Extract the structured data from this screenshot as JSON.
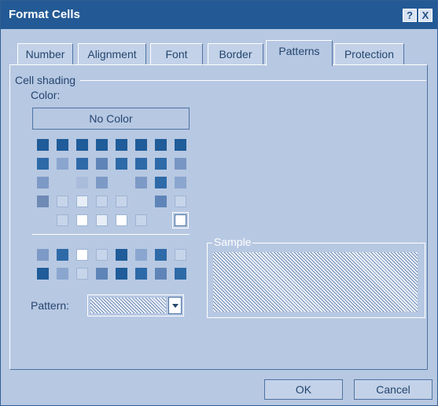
{
  "window": {
    "title": "Format Cells",
    "help_label": "?",
    "close_label": "X"
  },
  "tabs": [
    {
      "label": "Number",
      "active": false
    },
    {
      "label": "Alignment",
      "active": false
    },
    {
      "label": "Font",
      "active": false
    },
    {
      "label": "Border",
      "active": false
    },
    {
      "label": "Patterns",
      "active": true
    },
    {
      "label": "Protection",
      "active": false
    }
  ],
  "shading": {
    "group_label": "Cell shading",
    "color_label": "Color:",
    "no_color_label": "No Color",
    "palette_rows": [
      [
        "#1f5c99",
        "#1f5c99",
        "#1f5c99",
        "#1f5c99",
        "#1f5c99",
        "#1f5c99",
        "#1f5c99",
        "#1f5c99"
      ],
      [
        "#2e6aa8",
        "#8aa6cf",
        "#2e6aa8",
        "#5f84b8",
        "#2e6aa8",
        "#2e6aa8",
        "#2e6aa8",
        "#7896c3"
      ],
      [
        "#7d99c6",
        "#b7c8e2",
        "#a9bcdc",
        "#7d99c6",
        "#b7c8e2",
        "#7d99c6",
        "#2e6aa8",
        "#8aa6cf"
      ],
      [
        "#6e8ab5",
        "#c7d5ea",
        "#e8eef7",
        "#c7d5ea",
        "#c7d5ea",
        "#b7c8e2",
        "#5f84b8",
        "#c7d5ea"
      ],
      [
        "#b7c8e2",
        "#c7d5ea",
        "#ffffff",
        "#e8eef7",
        "#ffffff",
        "#c7d5ea",
        "#b7c8e2",
        "#ffffff"
      ]
    ],
    "extra_rows": [
      [
        "#7d99c6",
        "#2e6aa8",
        "#ffffff",
        "#c7d5ea",
        "#1f5c99",
        "#8aa6cf",
        "#2e6aa8",
        "#c7d5ea"
      ],
      [
        "#1f5c99",
        "#8aa6cf",
        "#c7d5ea",
        "#5f84b8",
        "#1f5c99",
        "#2e6aa8",
        "#5f84b8",
        "#2e6aa8"
      ]
    ]
  },
  "pattern": {
    "label": "Pattern:"
  },
  "sample": {
    "label": "Sample"
  },
  "buttons": {
    "ok": "OK",
    "cancel": "Cancel"
  }
}
